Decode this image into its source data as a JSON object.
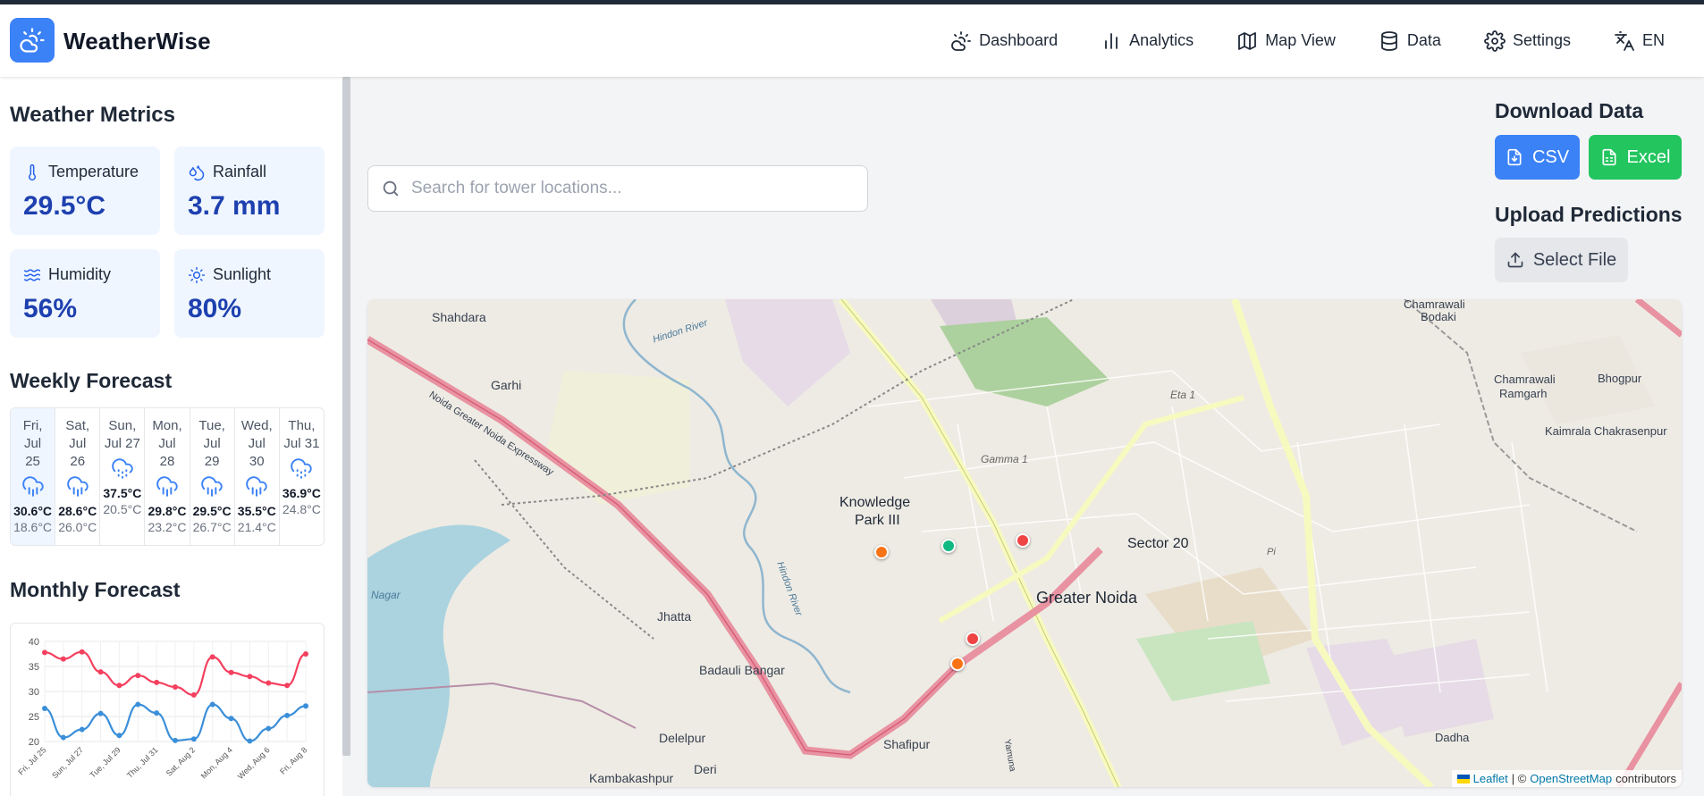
{
  "app": {
    "brand": "WeatherWise"
  },
  "nav": [
    {
      "label": "Dashboard",
      "icon": "sun-cloud-icon"
    },
    {
      "label": "Analytics",
      "icon": "bar-chart-icon"
    },
    {
      "label": "Map View",
      "icon": "map-icon"
    },
    {
      "label": "Data",
      "icon": "database-icon"
    },
    {
      "label": "Settings",
      "icon": "gear-icon"
    },
    {
      "label": "EN",
      "icon": "translate-icon"
    }
  ],
  "sidebar": {
    "metrics_title": "Weather Metrics",
    "metrics": [
      {
        "label": "Temperature",
        "value": "29.5°C",
        "icon": "thermometer-icon"
      },
      {
        "label": "Rainfall",
        "value": "3.7 mm",
        "icon": "droplets-icon"
      },
      {
        "label": "Humidity",
        "value": "56%",
        "icon": "waves-icon"
      },
      {
        "label": "Sunlight",
        "value": "80%",
        "icon": "sun-icon"
      }
    ],
    "weekly_title": "Weekly Forecast",
    "weekly": [
      {
        "l1": "Fri,",
        "l2": "Jul",
        "l3": "25",
        "hi": "30.6°C",
        "lo": "18.6°C"
      },
      {
        "l1": "Sat,",
        "l2": "Jul",
        "l3": "26",
        "hi": "28.6°C",
        "lo": "26.0°C"
      },
      {
        "l1": "Sun,",
        "l2": "Jul 27",
        "l3": "",
        "hi": "37.5°C",
        "lo": "20.5°C"
      },
      {
        "l1": "Mon,",
        "l2": "Jul",
        "l3": "28",
        "hi": "29.8°C",
        "lo": "23.2°C"
      },
      {
        "l1": "Tue,",
        "l2": "Jul",
        "l3": "29",
        "hi": "29.5°C",
        "lo": "26.7°C"
      },
      {
        "l1": "Wed,",
        "l2": "Jul",
        "l3": "30",
        "hi": "35.5°C",
        "lo": "21.4°C"
      },
      {
        "l1": "Thu,",
        "l2": "Jul 31",
        "l3": "",
        "hi": "36.9°C",
        "lo": "24.8°C"
      }
    ],
    "monthly_title": "Monthly Forecast"
  },
  "chart_data": {
    "type": "line",
    "x": [
      "Fri, Jul 25",
      "Sat, Jul 26",
      "Sun, Jul 27",
      "Mon, Jul 28",
      "Tue, Jul 29",
      "Wed, Jul 30",
      "Thu, Jul 31",
      "Fri, Aug 1",
      "Sat, Aug 2",
      "Sun, Aug 3",
      "Mon, Aug 4",
      "Tue, Aug 5",
      "Wed, Aug 6",
      "Thu, Aug 7",
      "Fri, Aug 8"
    ],
    "xtick_labels": [
      "Fri, Jul 25",
      "Sun, Jul 27",
      "Tue, Jul 29",
      "Thu, Jul 31",
      "Sat, Aug 2",
      "Mon, Aug 4",
      "Wed, Aug 6",
      "Fri, Aug 8"
    ],
    "ylim": [
      20,
      40
    ],
    "yticks": [
      20,
      25,
      30,
      35,
      40
    ],
    "grid": true,
    "series": [
      {
        "color": "#f43f5e",
        "values": [
          37.8,
          36.5,
          37.9,
          33.9,
          31.2,
          33.2,
          31.8,
          30.9,
          29.3,
          36.9,
          33.8,
          33.0,
          31.7,
          31.2,
          37.5
        ]
      },
      {
        "color": "#3b8fd9",
        "values": [
          26.6,
          20.8,
          22.4,
          25.6,
          21.2,
          27.4,
          25.7,
          20.2,
          20.5,
          27.4,
          24.6,
          20.1,
          22.6,
          25.2,
          27.1
        ]
      }
    ]
  },
  "main": {
    "search_placeholder": "Search for tower locations...",
    "download_title": "Download Data",
    "csv_label": "CSV",
    "excel_label": "Excel",
    "upload_title": "Upload Predictions",
    "select_label": "Select File"
  },
  "map": {
    "labels": [
      "Shahdara",
      "Garhi",
      "Hindon River",
      "Noida Greater Noida Expressway",
      "Knowledge",
      "Park III",
      "Gamma 1",
      "Eta 1",
      "Sector 20",
      "Greater Noida",
      "Jhatta",
      "Badauli Bangar",
      "Delelpur",
      "Deri",
      "Shafipur",
      "Kambakashpur",
      "Chamrawali",
      "Bodaki",
      "Chamrawali",
      "Ramgarh",
      "Bhogpur",
      "Kaimrala Chakrasenpur",
      "Dadha",
      "Nagar",
      "Hindon River",
      "Pi",
      "Yamuna"
    ],
    "attribution": {
      "leaflet": "Leaflet",
      "sep": "| ©",
      "osm": "OpenStreetMap",
      "suffix": "contributors"
    },
    "markers": [
      {
        "color": "#f97316"
      },
      {
        "color": "#10b981"
      },
      {
        "color": "#ef4444"
      },
      {
        "color": "#ef4444"
      },
      {
        "color": "#f97316"
      }
    ]
  }
}
